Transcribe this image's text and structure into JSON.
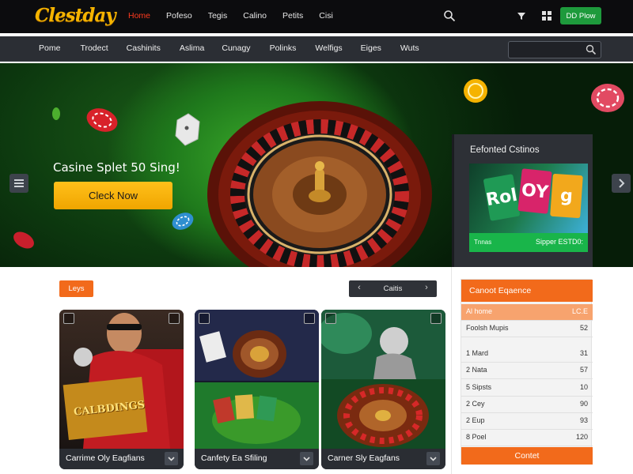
{
  "brand": {
    "logo_text": "Clestday"
  },
  "top_nav": {
    "items": [
      "Home",
      "Pofeso",
      "Tegis",
      "Calino",
      "Petits",
      "Cisi"
    ],
    "active_index": 0,
    "login_label": "DD Plow"
  },
  "sub_nav": {
    "items": [
      "Pome",
      "Trodect",
      "Cashinits",
      "Aslima",
      "Cunagy",
      "Polinks",
      "Welfigs",
      "Eiges",
      "Wuts"
    ],
    "search_placeholder": ""
  },
  "hero": {
    "title": "Casine Splet 50 Sing!",
    "cta_label": "Clеck Now"
  },
  "featured": {
    "title": "Eefonted Cstinos",
    "tiles": [
      "Rol",
      "OY",
      "g"
    ],
    "bar_left": "Tnnas",
    "bar_right": "Sipper ESTD0:"
  },
  "games_section": {
    "tag_label": "Leys",
    "pager_label": "Caitis",
    "cards": [
      {
        "caption": "Carrime Oly Eagfians"
      },
      {
        "caption": "Canfety Ea Sfiling"
      },
      {
        "caption": "Carner Sly Eagfans"
      }
    ],
    "card_art_text": "CALBDINGS"
  },
  "leaderboard": {
    "title": "Canoot Eqaence",
    "subheader": {
      "name": "Al home",
      "value": "LC.E"
    },
    "rows": [
      {
        "name": "Foolsh Mupis",
        "value": "52"
      },
      {
        "name": "1  Mard",
        "value": "31"
      },
      {
        "name": "2  Nata",
        "value": "57"
      },
      {
        "name": "5  Sipsts",
        "value": "10"
      },
      {
        "name": "2  Cey",
        "value": "90"
      },
      {
        "name": "2  Eup",
        "value": "93"
      },
      {
        "name": "8  Poel",
        "value": "120"
      }
    ],
    "button_label": "Contet"
  },
  "colors": {
    "accent_orange": "#f26a1b",
    "cta_yellow": "#ffc01a",
    "login_green": "#1e9a3c",
    "nav_active": "#ff3b1f"
  }
}
